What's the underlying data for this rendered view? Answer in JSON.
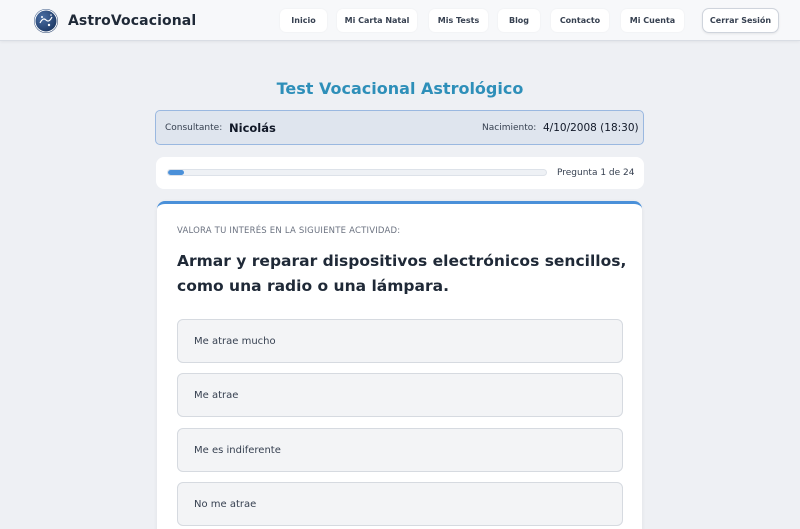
{
  "brand": {
    "name": "AstroVocacional"
  },
  "nav": {
    "items": [
      "Inicio",
      "Mi Carta Natal",
      "Mis Tests",
      "Blog",
      "Contacto",
      "Mi Cuenta"
    ],
    "logout_label": "Cerrar Sesión"
  },
  "page": {
    "title": "Test Vocacional Astrológico"
  },
  "consultant": {
    "label": "Consultante:",
    "name": "Nicolás",
    "birth_label": "Nacimiento:",
    "birth_value": "4/10/2008 (18:30)"
  },
  "progress": {
    "text": "Pregunta 1 de 24",
    "current": 1,
    "total": 24,
    "accent": "#4a90d9"
  },
  "question": {
    "kicker": "VALORA TU INTERÉS EN LA SIGUIENTE ACTIVIDAD:",
    "text": "Armar y reparar dispositivos electrónicos sencillos, como una radio o una lámpara.",
    "options": [
      "Me atrae mucho",
      "Me atrae",
      "Me es indiferente",
      "No me atrae"
    ]
  },
  "colors": {
    "title": "#2e8fb9",
    "accent": "#4a90d9",
    "background": "#eef0f4"
  }
}
